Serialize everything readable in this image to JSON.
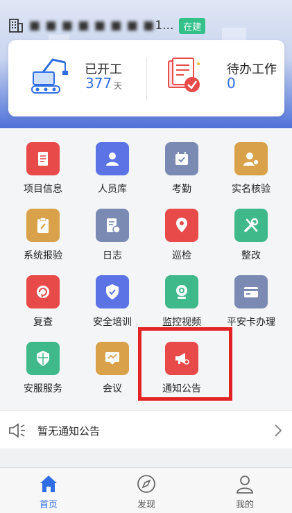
{
  "header": {
    "project_name": "■ ■ ■ ■ ■ ■ ■ ■",
    "ellipsis": "1...",
    "status_badge": "在建"
  },
  "stats": {
    "started": {
      "title": "已开工",
      "value": "377",
      "unit": "天"
    },
    "todo": {
      "title": "待办工作",
      "value": "0"
    }
  },
  "grid": {
    "items": [
      {
        "label": "项目信息",
        "icon": "document-list-icon",
        "color": "#e84a4a"
      },
      {
        "label": "人员库",
        "icon": "person-icon",
        "color": "#5c73e6"
      },
      {
        "label": "考勤",
        "icon": "calendar-check-icon",
        "color": "#7a8ab3"
      },
      {
        "label": "实名核验",
        "icon": "person-verify-icon",
        "color": "#d9a24a"
      },
      {
        "label": "系统报验",
        "icon": "clipboard-tool-icon",
        "color": "#d9a24a"
      },
      {
        "label": "日志",
        "icon": "log-clock-icon",
        "color": "#7a8ab3"
      },
      {
        "label": "巡检",
        "icon": "location-pin-icon",
        "color": "#e84a4a"
      },
      {
        "label": "整改",
        "icon": "wrench-icon",
        "color": "#3fb88a"
      },
      {
        "label": "复查",
        "icon": "refresh-icon",
        "color": "#e84a4a"
      },
      {
        "label": "安全培训",
        "icon": "shield-check-icon",
        "color": "#5c73e6"
      },
      {
        "label": "监控视频",
        "icon": "camera-icon",
        "color": "#3fb88a"
      },
      {
        "label": "平安卡办理",
        "icon": "card-icon",
        "color": "#7a8ab3"
      },
      {
        "label": "安服服务",
        "icon": "shield-icon",
        "color": "#3fb88a"
      },
      {
        "label": "会议",
        "icon": "presentation-icon",
        "color": "#d9a24a"
      },
      {
        "label": "通知公告",
        "icon": "megaphone-icon",
        "color": "#e84a4a"
      }
    ]
  },
  "notice": {
    "text": "暂无通知公告"
  },
  "tabbar": {
    "tabs": [
      {
        "label": "首页",
        "icon": "home-icon",
        "active": true
      },
      {
        "label": "发现",
        "icon": "compass-icon",
        "active": false
      },
      {
        "label": "我的",
        "icon": "user-icon",
        "active": false
      }
    ]
  },
  "colors": {
    "accent": "#2f6de5",
    "badge": "#33c189",
    "highlight": "#e32323"
  }
}
